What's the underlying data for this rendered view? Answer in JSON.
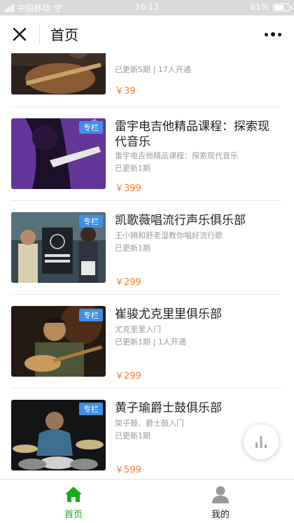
{
  "status_bar": {
    "carrier": "中国移动",
    "time": "16:13",
    "battery": "61%",
    "battery_level": 0.61
  },
  "nav": {
    "title": "首页",
    "close_icon": "close-icon",
    "more_icon": "more-icon"
  },
  "badge_label": "专栏",
  "items": [
    {
      "title": "",
      "subtitle": "",
      "meta": "已更新5期 | 17人开通",
      "price": "￥39"
    },
    {
      "title": "雷宇电吉他精品课程：探索现代音乐",
      "subtitle": "雷宇电吉他精品课程：探索现代音乐",
      "meta": "已更新1期",
      "price": "￥399"
    },
    {
      "title": "凯歌薇唱流行声乐俱乐部",
      "subtitle": "王小狮和舒老湿教你唱好流行歌",
      "meta": "已更新1期",
      "price": "￥299"
    },
    {
      "title": "崔骏尤克里里俱乐部",
      "subtitle": "尤克里里入门",
      "meta": "已更新1期 | 1人开通",
      "price": "￥299"
    },
    {
      "title": "黄子瑜爵士鼓俱乐部",
      "subtitle": "架子鼓、爵士鼓入门",
      "meta": "已更新1期",
      "price": "￥599"
    }
  ],
  "tabs": [
    {
      "label": "首页",
      "icon": "home-icon",
      "active": true,
      "color": "#1aad19"
    },
    {
      "label": "我的",
      "icon": "user-icon",
      "active": false,
      "color": "#222222"
    }
  ],
  "colors": {
    "accent": "#1aad19",
    "price": "#ff7a2f",
    "badge": "#3d8fe8"
  }
}
